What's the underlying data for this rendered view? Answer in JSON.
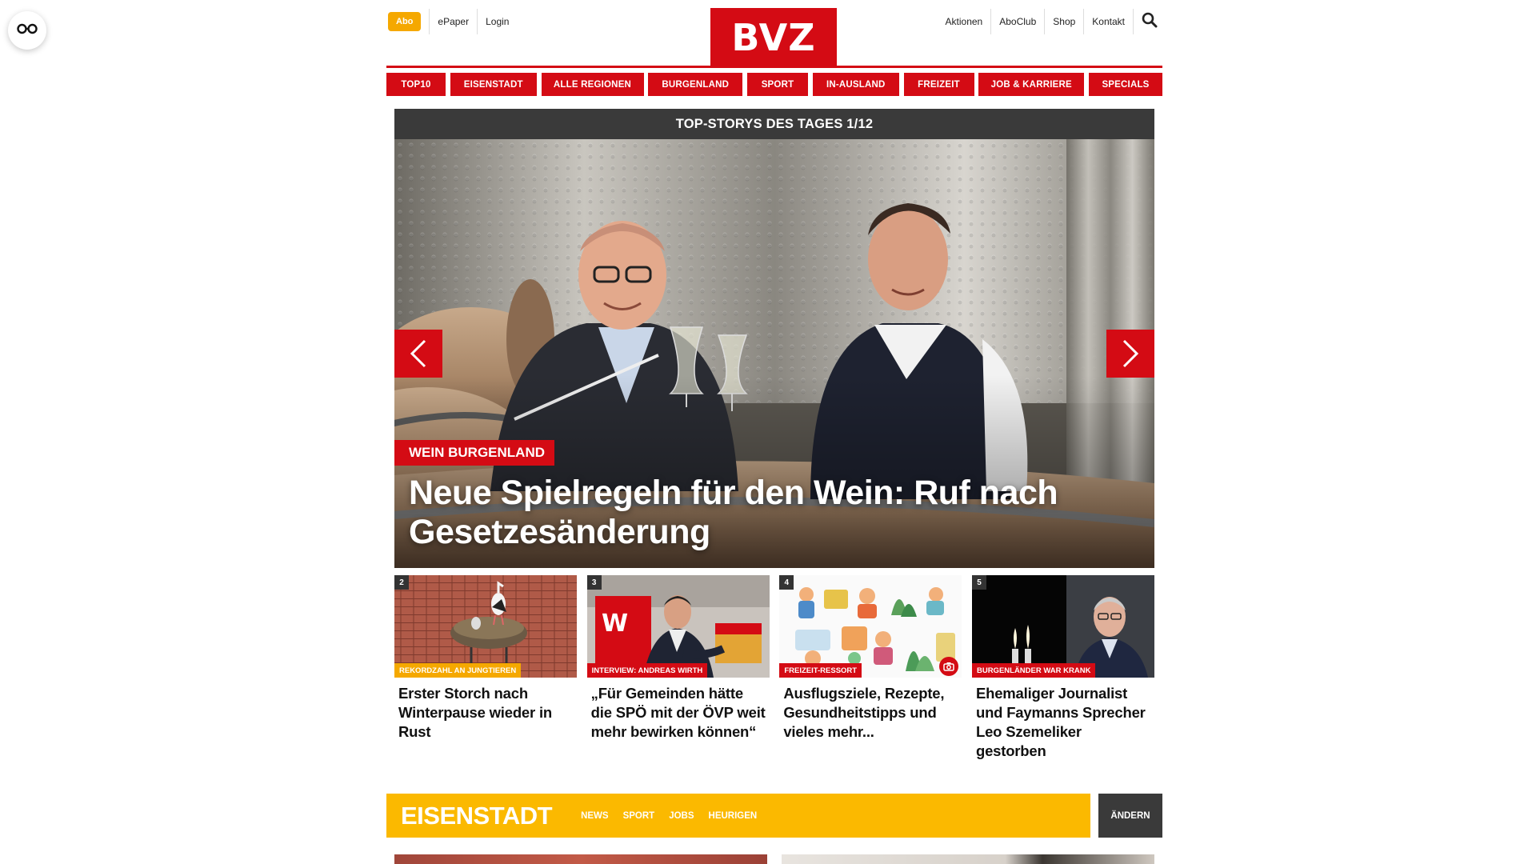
{
  "header": {
    "abo_label": "Abo",
    "left_links": [
      "ePaper",
      "Login"
    ],
    "logo_text": "BVZ",
    "right_links": [
      "Aktionen",
      "AboClub",
      "Shop",
      "Kontakt"
    ],
    "search_icon": "search-icon",
    "accessibility_icon": "glasses-icon"
  },
  "nav": {
    "items": [
      "TOP10",
      "EISENSTADT",
      "ALLE REGIONEN",
      "BURGENLAND",
      "SPORT",
      "IN-AUSLAND",
      "FREIZEIT",
      "JOB & KARRIERE",
      "SPECIALS"
    ]
  },
  "slider": {
    "heading": "TOP-STORYS DES TAGES 1/12",
    "hero": {
      "kicker": "WEIN BURGENLAND",
      "title": "Neue Spielregeln für den Wein: Ruf nach Gesetzesänderung"
    },
    "prev_icon": "chevron-left-icon",
    "next_icon": "chevron-right-icon"
  },
  "cards": [
    {
      "number": "2",
      "kicker": "REKORDZAHL AN JUNGTIEREN",
      "kicker_color": "#f5a800",
      "title": "Erster Storch nach Winterpause wieder in Rust"
    },
    {
      "number": "3",
      "kicker": "INTERVIEW: ANDREAS WIRTH",
      "kicker_color": "#d40b14",
      "title": "„Für Gemeinden hätte die SPÖ mit der ÖVP weit mehr bewirken können“"
    },
    {
      "number": "4",
      "kicker": "FREIZEIT-RESSORT",
      "kicker_color": "#d40b14",
      "title": "Ausflugsziele, Rezepte, Gesundheitstipps und vieles mehr...",
      "badge_icon": "camera-icon"
    },
    {
      "number": "5",
      "kicker": "BURGENLÄNDER WAR KRANK",
      "kicker_color": "#d40b14",
      "title": "Ehemaliger Journalist und Faymanns Sprecher Leo Szemeliker gestorben"
    }
  ],
  "section": {
    "title": "EISENSTADT",
    "links": [
      "NEWS",
      "SPORT",
      "JOBS",
      "HEURIGEN"
    ],
    "change_label": "ÄNDERN"
  },
  "colors": {
    "brand_red": "#d40b14",
    "accent_yellow": "#fbb900",
    "dark_gray": "#3a3a3a"
  }
}
